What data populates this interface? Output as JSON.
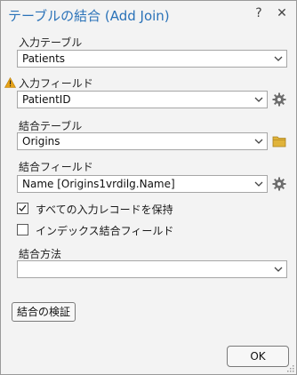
{
  "window": {
    "title": "テーブルの結合 (Add Join)",
    "help_label": "?",
    "close_label": "✕"
  },
  "fields": {
    "input_table": {
      "label": "入力テーブル",
      "value": "Patients"
    },
    "input_field": {
      "label": "入力フィールド",
      "value": "PatientID",
      "warning_icon": "warning-icon"
    },
    "join_table": {
      "label": "結合テーブル",
      "value": "Origins"
    },
    "join_field": {
      "label": "結合フィールド",
      "value": "Name [Origins1vrdilg.Name]"
    },
    "keep_all": {
      "label": "すべての入力レコードを保持",
      "checked": true
    },
    "index_join_fields": {
      "label": "インデックス結合フィールド",
      "checked": false
    },
    "join_operation": {
      "label": "結合方法",
      "value": ""
    }
  },
  "buttons": {
    "validate_label": "結合の検証",
    "ok_label": "OK"
  },
  "colors": {
    "title": "#2a72b8",
    "warning": "#e8a317",
    "folder": "#e0b33a"
  },
  "icons": [
    "help-icon",
    "close-icon",
    "chevron-down-icon",
    "warning-icon",
    "gear-icon",
    "folder-icon",
    "checkmark-icon"
  ]
}
